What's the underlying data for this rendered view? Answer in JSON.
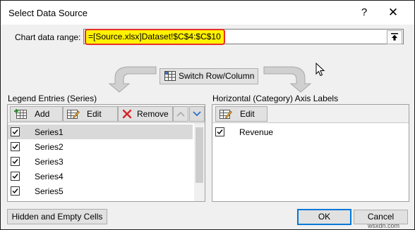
{
  "window": {
    "title": "Select Data Source",
    "help_glyph": "?",
    "close_glyph": "✕"
  },
  "range": {
    "label": "Chart data range:",
    "value": "=[Source.xlsx]Dataset!$C$4:$C$10"
  },
  "switch_button": {
    "label": "Switch Row/Column"
  },
  "series_panel": {
    "label": "Legend Entries (Series)",
    "add_label": "Add",
    "edit_label": "Edit",
    "remove_label": "Remove",
    "items": [
      {
        "label": "Series1",
        "checked": true,
        "selected": true
      },
      {
        "label": "Series2",
        "checked": true
      },
      {
        "label": "Series3",
        "checked": true
      },
      {
        "label": "Series4",
        "checked": true
      },
      {
        "label": "Series5",
        "checked": true
      }
    ]
  },
  "category_panel": {
    "label": "Horizontal (Category) Axis Labels",
    "edit_label": "Edit",
    "items": [
      {
        "label": "Revenue",
        "checked": true
      }
    ]
  },
  "footer": {
    "hidden_cells_label": "Hidden and Empty Cells",
    "ok_label": "OK",
    "cancel_label": "Cancel"
  },
  "watermark": "wsxdn.com",
  "colors": {
    "highlight_fill": "#fff200",
    "highlight_border": "#e8302a",
    "focus_border": "#0078d7",
    "remove_icon": "#d8232a"
  },
  "icons": {
    "add": "table-add-icon",
    "edit": "table-edit-icon",
    "remove": "red-x-icon",
    "up": "arrow-up-icon",
    "down": "arrow-down-icon",
    "collapse": "collapse-up-icon",
    "switch": "switch-row-column-icon"
  }
}
